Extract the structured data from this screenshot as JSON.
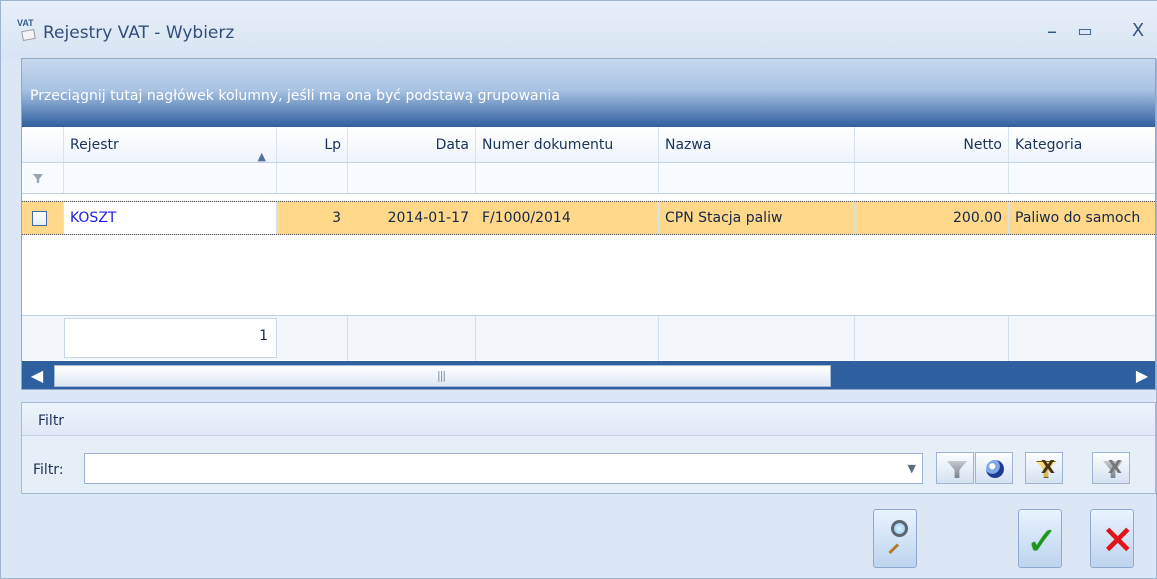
{
  "window": {
    "title": "Rejestry VAT - Wybierz",
    "icon_label": "VAT",
    "controls": [
      "–",
      "▭",
      "X"
    ]
  },
  "grid": {
    "group_hint": "Przeciągnij tutaj nagłówek kolumny, jeśli ma ona być podstawą grupowania",
    "columns": [
      "Rejestr",
      "Lp",
      "Data",
      "Numer dokumentu",
      "Nazwa",
      "Netto",
      "Kategoria"
    ],
    "sort_indicator": "▲",
    "rows": [
      {
        "rejestr": "KOSZT",
        "lp": "3",
        "data": "2014-01-17",
        "numer_dokumentu": "F/1000/2014",
        "nazwa": "CPN Stacja paliw",
        "netto": "200.00",
        "kategoria": "Paliwo do samoch"
      }
    ],
    "record_count": "1"
  },
  "filter": {
    "section_title": "Filtr",
    "label": "Filtr:",
    "value": "",
    "buttons": [
      "filter-options-icon",
      "clear-filter-icon",
      "apply-filter-icon",
      "disabled-filter-icon"
    ]
  },
  "actions": {
    "preview_icon": "magnifier-icon",
    "ok_icon": "checkmark-icon",
    "cancel_icon": "cancel-x-icon"
  },
  "colors": {
    "selected_row": "#ffd889",
    "header_blue": "#2f5f9e",
    "accent_text": "#1e1ee8"
  }
}
